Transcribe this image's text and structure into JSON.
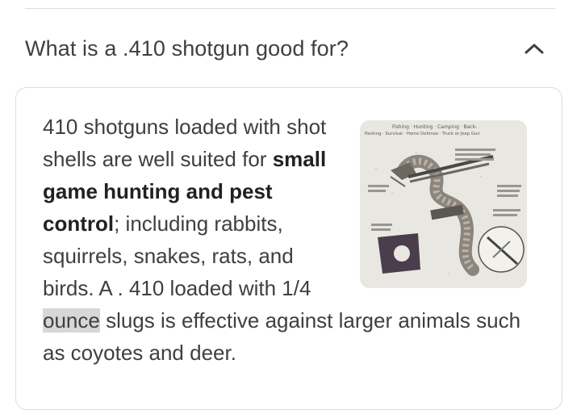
{
  "question": {
    "text": "What is a .410 shotgun good for?",
    "expand_icon": "chevron-up-icon"
  },
  "answer": {
    "part1": "410 shotguns loaded with shot shells are well suited for ",
    "bold": "small game hunting and pest control",
    "part2": "; including rabbits, squirrels, snakes, rats, and birds. A . 410 loaded with 1/4 ",
    "highlight": "ounce",
    "part3": " slugs is effective against larger animals such as coyotes and deer."
  },
  "image": {
    "caption_lines": [
      "Fishing · Hunting · Camping · Back-",
      "Packing · Survival · Home Defense · Truck or Jeep Gun"
    ]
  },
  "colors": {
    "text": "#3c4043",
    "border": "#dadce0",
    "highlight": "#d7d7d7"
  }
}
